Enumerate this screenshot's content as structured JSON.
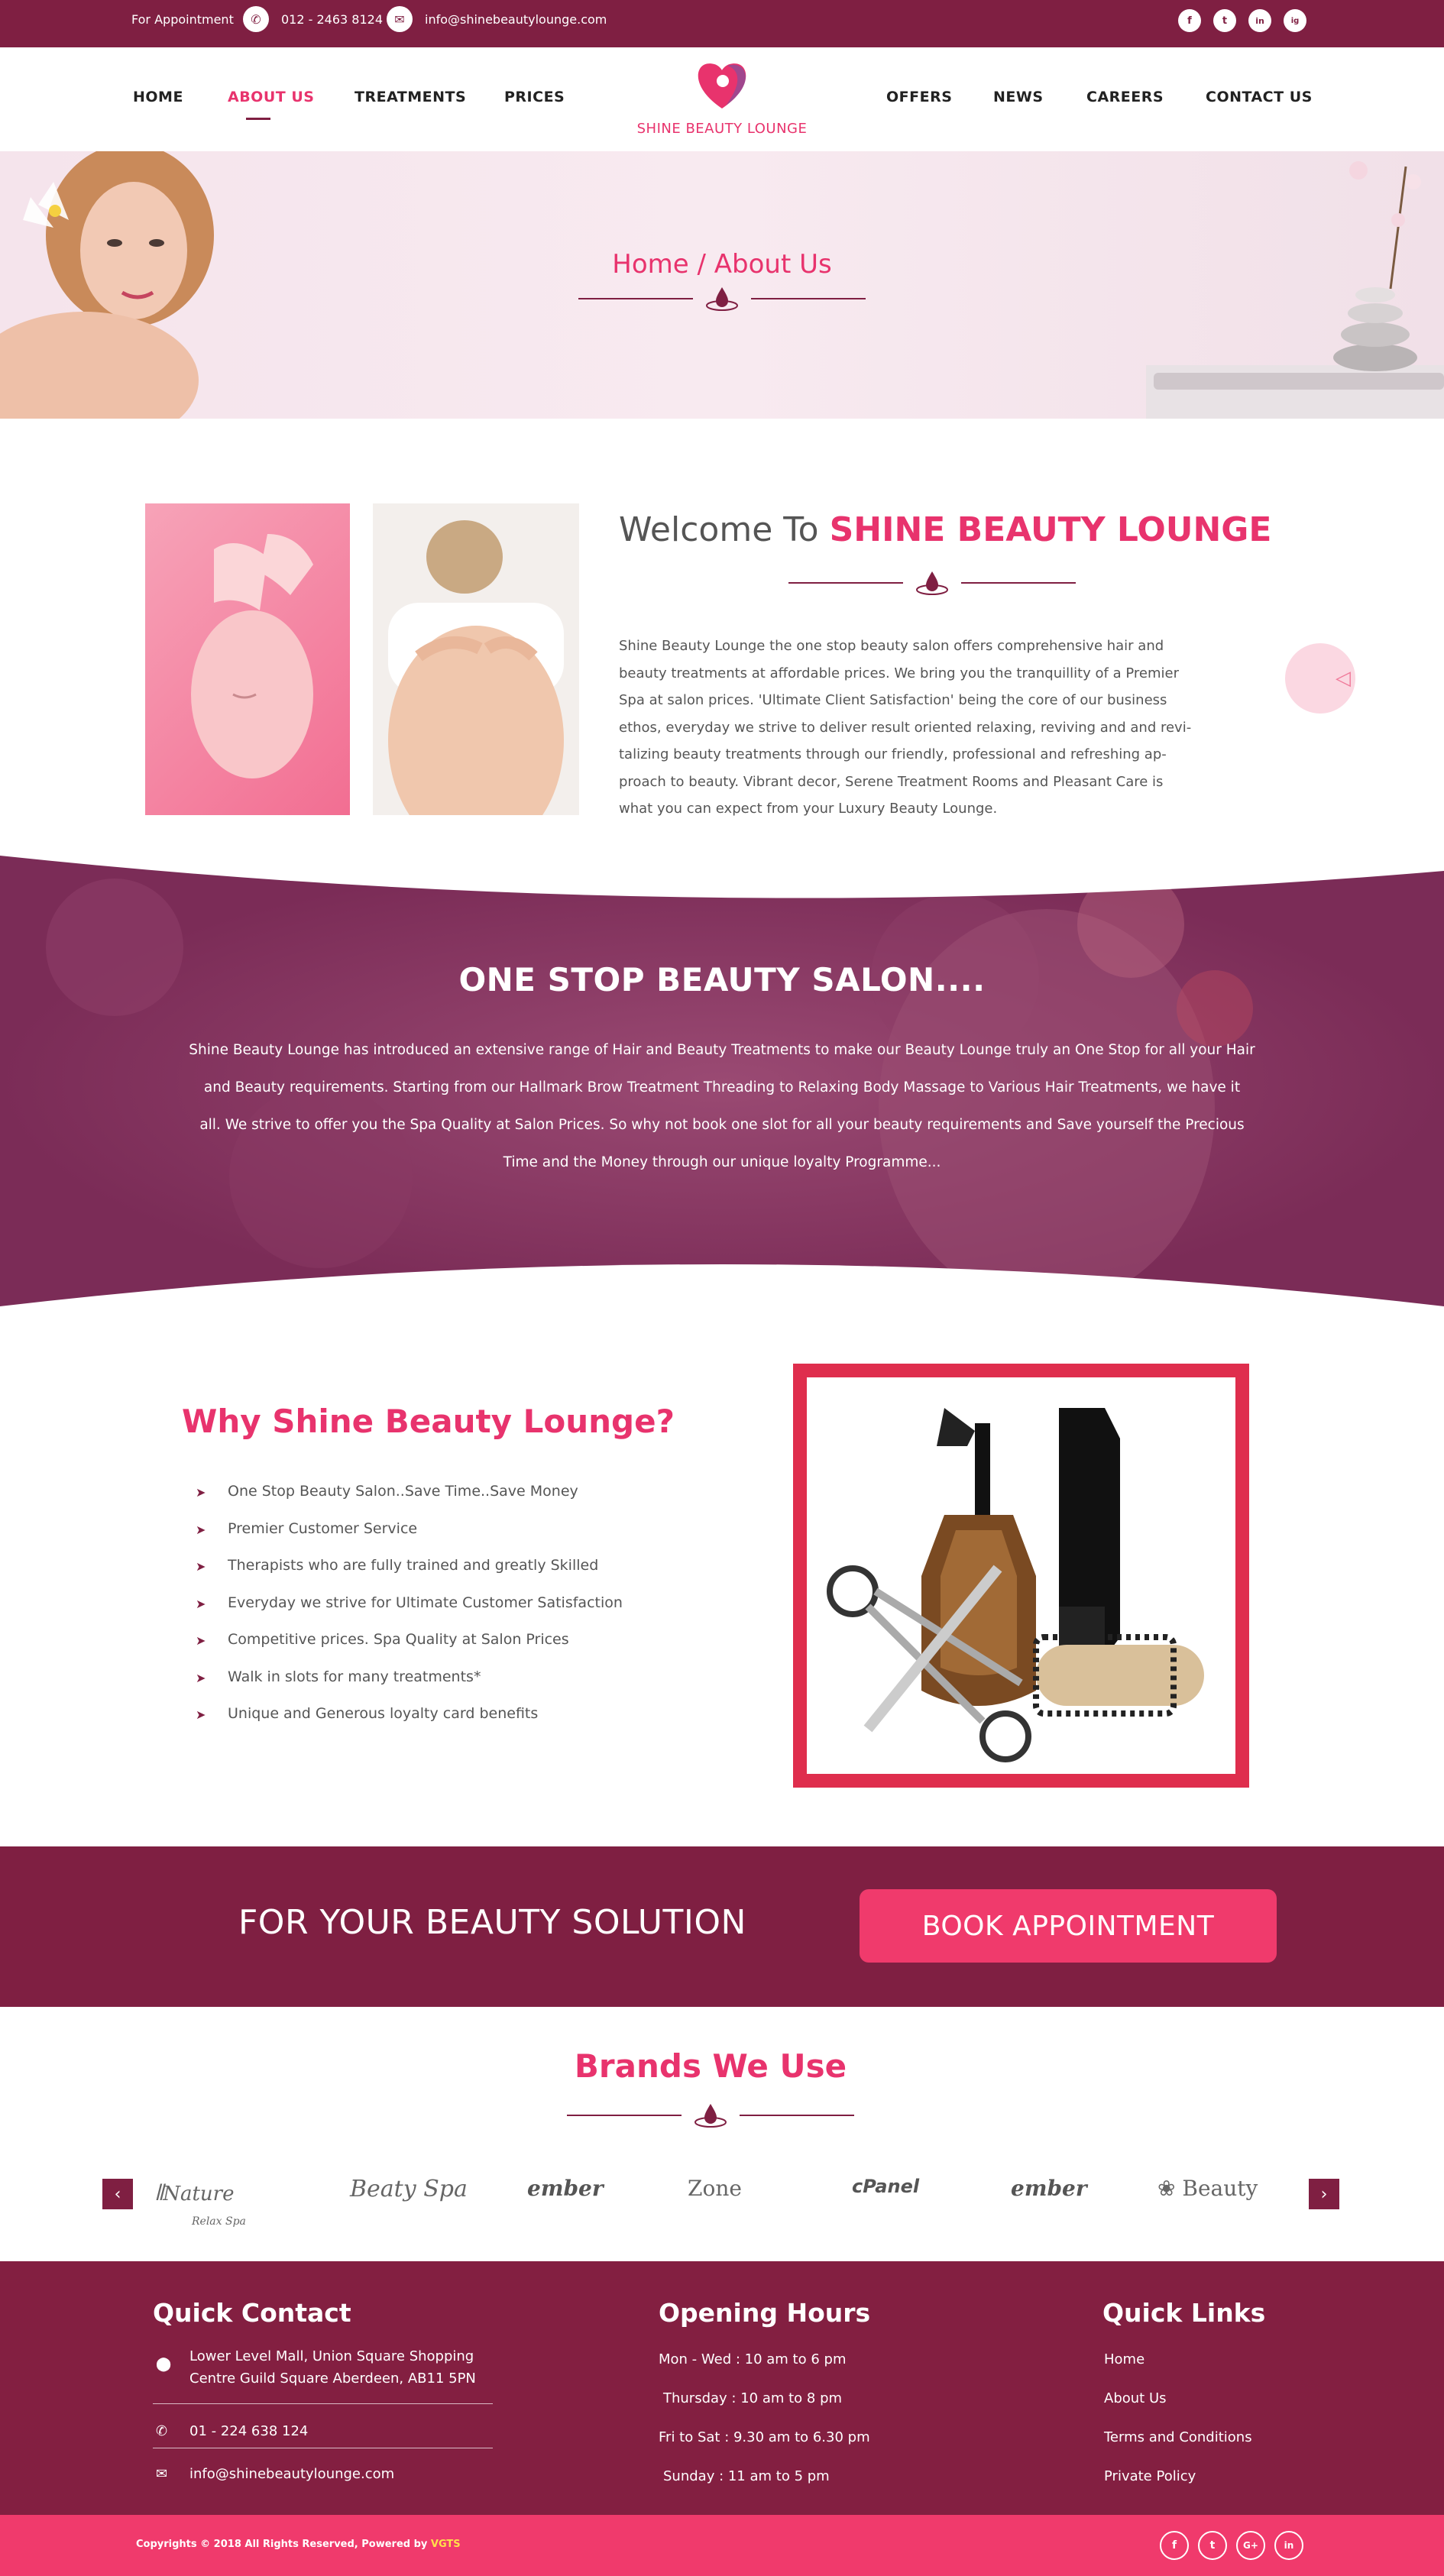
{
  "topbar": {
    "appointment_label": "For Appointment",
    "phone": "012 - 2463 8124",
    "email": "info@shinebeautylounge.com",
    "social": [
      "f",
      "t",
      "in",
      "ig"
    ]
  },
  "nav": {
    "left": [
      "HOME",
      "ABOUT US",
      "TREATMENTS",
      "PRICES"
    ],
    "right": [
      "OFFERS",
      "NEWS",
      "CAREERS",
      "CONTACT US"
    ],
    "logo_text": "SHINE BEAUTY LOUNGE",
    "active": "ABOUT US"
  },
  "hero": {
    "breadcrumb": "Home / About Us"
  },
  "welcome": {
    "heading_prefix": "Welcome To",
    "heading_brand": "SHINE BEAUTY LOUNGE",
    "lines": [
      "Shine Beauty Lounge the one stop beauty salon offers comprehensive hair and",
      "beauty treatments at affordable prices. We bring you the tranquillity of a Premier",
      "Spa at salon prices. 'Ultimate Client Satisfaction' being the core of our business",
      "ethos, everyday we strive to deliver result oriented relaxing, reviving and and revi-",
      "talizing beauty treatments through our friendly, professional and refreshing ap-",
      "proach to beauty. Vibrant decor,  Serene Treatment Rooms and Pleasant Care is",
      "what you can expect from your Luxury  Beauty Lounge."
    ]
  },
  "band": {
    "title": "ONE STOP BEAUTY SALON....",
    "lines": [
      "Shine Beauty Lounge has introduced an extensive range of Hair and Beauty Treatments to make our Beauty Lounge truly an One Stop for all your Hair",
      "and Beauty requirements. Starting from our Hallmark Brow Treatment Threading to Relaxing Body Massage to Various Hair Treatments, we have it",
      "all. We strive to offer you the Spa Quality at Salon Prices. So why not book one slot for all your beauty requirements and Save yourself the Precious",
      "Time and the Money through our unique loyalty Programme..."
    ]
  },
  "why": {
    "title": "Why Shine Beauty Lounge?",
    "items": [
      "One Stop Beauty Salon..Save Time..Save Money",
      "Premier Customer Service",
      "Therapists who are fully trained and greatly Skilled",
      "Everyday we strive for Ultimate Customer Satisfaction",
      "Competitive prices. Spa Quality at Salon Prices",
      "Walk in slots for many treatments*",
      "Unique and Generous loyalty card benefits"
    ]
  },
  "cta": {
    "text": "FOR YOUR BEAUTY SOLUTION",
    "button": "BOOK APPOINTMENT"
  },
  "brands": {
    "title": "Brands We Use",
    "items": [
      "Nature",
      "Relax Spa",
      "Beaty Spa",
      "ember",
      "Zone",
      "cPanel",
      "ember",
      "Beauty"
    ],
    "prev": "‹",
    "next": "›"
  },
  "footer": {
    "quick_contact": {
      "title": "Quick Contact",
      "address_line1": "Lower Level Mall, Union Square Shopping",
      "address_line2": "Centre Guild Square Aberdeen, AB11 5PN",
      "phone": "01 - 224 638 124",
      "email": "info@shinebeautylounge.com"
    },
    "hours": {
      "title": "Opening Hours",
      "items": [
        "Mon - Wed : 10 am to 6 pm",
        "Thursday : 10 am  to 8 pm",
        "Fri to Sat : 9.30 am  to 6.30 pm",
        "Sunday : 11 am to 5 pm"
      ]
    },
    "links": {
      "title": "Quick Links",
      "items": [
        "Home",
        "About Us",
        "Terms and Conditions",
        "Private Policy"
      ]
    },
    "copyright": "Copyrights © 2018 All Rights Reserved, Powered by",
    "powered_by": "VGTS",
    "social": [
      "f",
      "t",
      "G+",
      "in"
    ]
  },
  "colors": {
    "primary": "#7f1f42",
    "accent": "#e8336d",
    "button": "#f03a6c"
  }
}
